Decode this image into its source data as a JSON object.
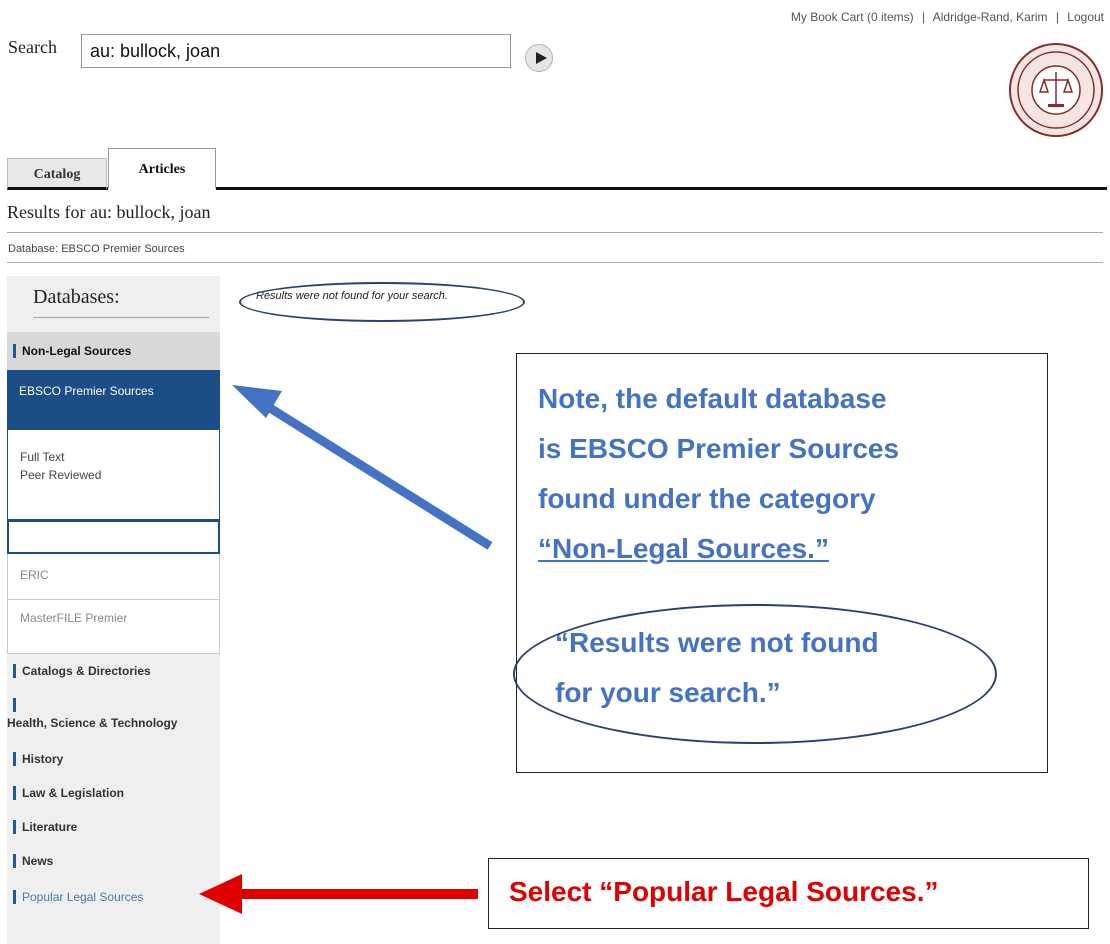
{
  "header": {
    "cart_link": "My Book Cart (0 items)",
    "user_link": "Aldridge-Rand, Karim",
    "logout_link": "Logout",
    "separator": "|"
  },
  "search": {
    "label": "Search",
    "value": "au: bullock, joan"
  },
  "tabs": [
    {
      "label": "Catalog"
    },
    {
      "label": "Articles"
    }
  ],
  "results": {
    "title": "Results for au: bullock, joan",
    "database_line": "Database: EBSCO Premier Sources",
    "message": "Results were not found for your search."
  },
  "sidebar": {
    "heading": "Databases:",
    "active_category": "Non-Legal Sources",
    "selected_database": "EBSCO Premier Sources",
    "options": [
      "Full Text",
      "Peer Reviewed"
    ],
    "databases": [
      "ERIC",
      "MasterFILE Premier"
    ],
    "categories": [
      "Catalogs & Directories",
      "Health, Science & Technology",
      "History",
      "Law & Legislation",
      "Literature",
      "News",
      "Popular Legal Sources"
    ]
  },
  "annotations": {
    "note_lines": [
      "Note, the default database",
      "is EBSCO Premier Sources",
      "found under the category",
      "“Non-Legal Sources.”"
    ],
    "quote_lines": [
      "“Results were not found",
      "for your search.”"
    ],
    "instruction": "Select “Popular Legal Sources.”",
    "colors": {
      "note": "#4472c4",
      "instruction": "#e00000",
      "oval": "#2c3e75",
      "blue_arrow": "#4472c4",
      "red_arrow": "#e00000"
    }
  },
  "icons": {
    "go": "play-triangle-icon",
    "seal": "law-school-seal-logo"
  }
}
